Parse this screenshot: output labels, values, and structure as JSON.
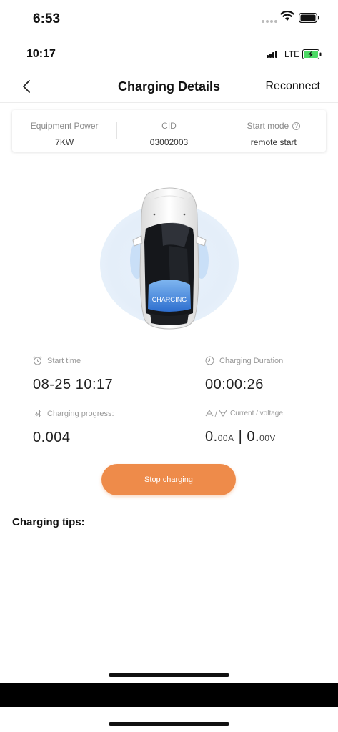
{
  "outer_status": {
    "time": "6:53"
  },
  "inner_status": {
    "time": "10:17",
    "network": "LTE"
  },
  "nav": {
    "title": "Charging Details",
    "reconnect": "Reconnect"
  },
  "info": [
    {
      "label": "Equipment Power",
      "value": "7KW"
    },
    {
      "label": "CID",
      "value": "03002003"
    },
    {
      "label": "Start mode",
      "value": "remote start"
    }
  ],
  "car": {
    "badge": "CHARGING"
  },
  "stats": {
    "start_time": {
      "label": "Start time",
      "value": "08-25 10:17"
    },
    "duration": {
      "label": "Charging Duration",
      "value": "00:00:26"
    },
    "progress": {
      "label": "Charging progress:",
      "value": "0.004"
    },
    "current_voltage": {
      "label": "Current / voltage",
      "current_int": "0.",
      "current_dec": "00A",
      "separator": "|",
      "voltage_int": "0.",
      "voltage_dec": "00V"
    }
  },
  "actions": {
    "stop": "Stop charging"
  },
  "tips": {
    "title": "Charging tips:"
  },
  "colors": {
    "accent": "#ee8b4a",
    "glow": "#e4eef9",
    "charge_blue": "#3b7fd8"
  },
  "icons": {
    "back": "chevron-left-icon",
    "start_time": "alarm-clock-icon",
    "duration": "clock-icon",
    "progress": "battery-icon",
    "current_voltage": "current-voltage-icon",
    "help": "question-mark-icon"
  }
}
